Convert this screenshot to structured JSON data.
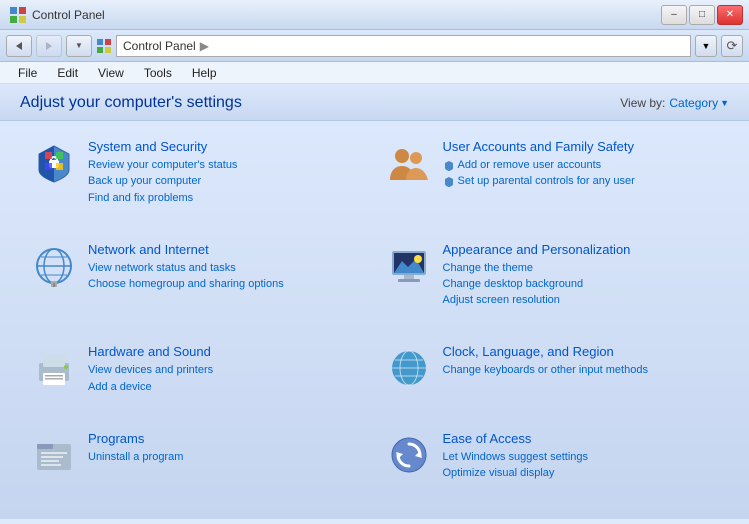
{
  "titleBar": {
    "title": "Control Panel",
    "minLabel": "–",
    "maxLabel": "□",
    "closeLabel": "✕"
  },
  "addressBar": {
    "back": "◄",
    "forward": "►",
    "down": "▼",
    "path": "Control Panel",
    "pathArrow": "►",
    "refresh": "⟳",
    "dropArrow": "▼"
  },
  "menuBar": {
    "items": [
      "File",
      "Edit",
      "View",
      "Tools",
      "Help"
    ]
  },
  "content": {
    "title": "Adjust your computer's settings",
    "viewByLabel": "View by:",
    "viewByValue": "Category",
    "viewByArrow": "▼"
  },
  "categories": [
    {
      "id": "system-security",
      "title": "System and Security",
      "links": [
        {
          "text": "Review your computer's status",
          "shield": false
        },
        {
          "text": "Back up your computer",
          "shield": false
        },
        {
          "text": "Find and fix problems",
          "shield": false
        }
      ]
    },
    {
      "id": "user-accounts",
      "title": "User Accounts and Family Safety",
      "links": [
        {
          "text": "Add or remove user accounts",
          "shield": true
        },
        {
          "text": "Set up parental controls for any user",
          "shield": true
        }
      ]
    },
    {
      "id": "network-internet",
      "title": "Network and Internet",
      "links": [
        {
          "text": "View network status and tasks",
          "shield": false
        },
        {
          "text": "Choose homegroup and sharing options",
          "shield": false
        }
      ]
    },
    {
      "id": "appearance",
      "title": "Appearance and Personalization",
      "links": [
        {
          "text": "Change the theme",
          "shield": false
        },
        {
          "text": "Change desktop background",
          "shield": false
        },
        {
          "text": "Adjust screen resolution",
          "shield": false
        }
      ]
    },
    {
      "id": "hardware-sound",
      "title": "Hardware and Sound",
      "links": [
        {
          "text": "View devices and printers",
          "shield": false
        },
        {
          "text": "Add a device",
          "shield": false
        }
      ]
    },
    {
      "id": "clock-language",
      "title": "Clock, Language, and Region",
      "links": [
        {
          "text": "Change keyboards or other input methods",
          "shield": false
        }
      ]
    },
    {
      "id": "programs",
      "title": "Programs",
      "links": [
        {
          "text": "Uninstall a program",
          "shield": false
        }
      ]
    },
    {
      "id": "ease-of-access",
      "title": "Ease of Access",
      "links": [
        {
          "text": "Let Windows suggest settings",
          "shield": false
        },
        {
          "text": "Optimize visual display",
          "shield": false
        }
      ]
    }
  ]
}
